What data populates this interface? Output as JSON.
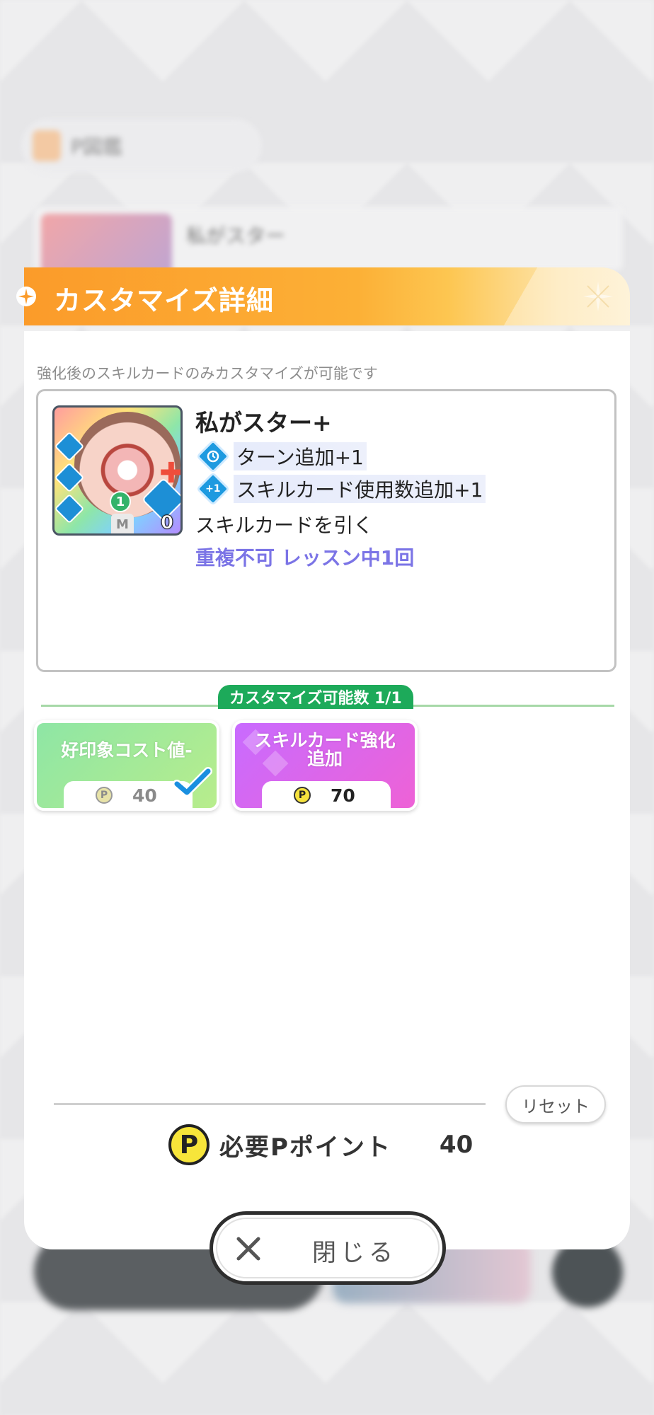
{
  "background": {
    "tab_label": "P図鑑",
    "card_title": "私がスター"
  },
  "modal": {
    "title": "カスタマイズ詳細",
    "note": "強化後のスキルカードのみカスタマイズが可能です",
    "card": {
      "name": "私がスター+",
      "art_cost": "1",
      "art_badge": "M",
      "art_count": "0",
      "effects": [
        {
          "icon": "turn-plus-icon",
          "icon_text": "",
          "text": "ターン追加+1"
        },
        {
          "icon": "card-use-plus-icon",
          "icon_text": "+1",
          "text": "スキルカード使用数追加+1"
        }
      ],
      "plain_effect": "スキルカードを引く",
      "limit_text": "重複不可 レッスン中1回"
    },
    "customize_count_label": "カスタマイズ可能数 1/1",
    "options": [
      {
        "label": "好印象コスト値-",
        "coin": "P",
        "cost": "40",
        "selected": true,
        "color": "#8ee6a5"
      },
      {
        "label": "スキルカード強化\n追加",
        "coin": "P",
        "cost": "70",
        "selected": false,
        "color": "#c86bff"
      }
    ],
    "reset_label": "リセット",
    "required_points_coin": "P",
    "required_points_label": "必要Pポイント",
    "required_points_value": "40"
  },
  "close_button": {
    "label": "閉じる",
    "icon": "close-icon"
  },
  "colors": {
    "header_orange": "#fb9b2a",
    "accent_green": "#1daa5a",
    "limit_purple": "#7b74e6",
    "effect_blue": "#1d9ae0",
    "check_blue": "#1a8fe0"
  }
}
